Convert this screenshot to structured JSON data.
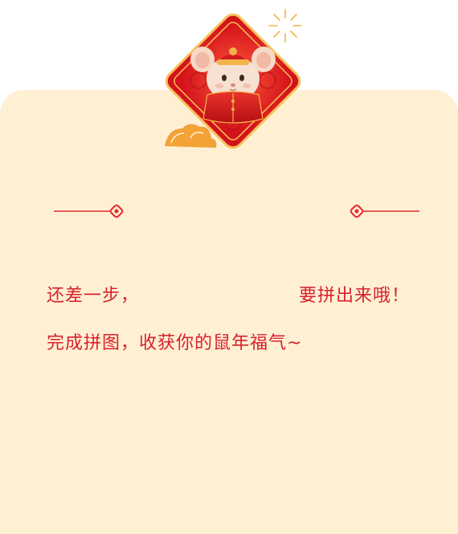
{
  "message": {
    "line1_prefix": "还差一步，",
    "line1_suffix": "要拼出来哦！",
    "line2": "完成拼图，收获你的鼠年福气~"
  },
  "colors": {
    "card_background": "#fff0d4",
    "text_red": "#d8212b",
    "badge_red": "#e0241e",
    "gold": "#f3b34a"
  },
  "icons": {
    "badge": "new-year-rat-badge-icon",
    "firework": "firework-icon",
    "cloud": "auspicious-cloud-icon",
    "divider_knot": "chinese-knot-icon"
  }
}
